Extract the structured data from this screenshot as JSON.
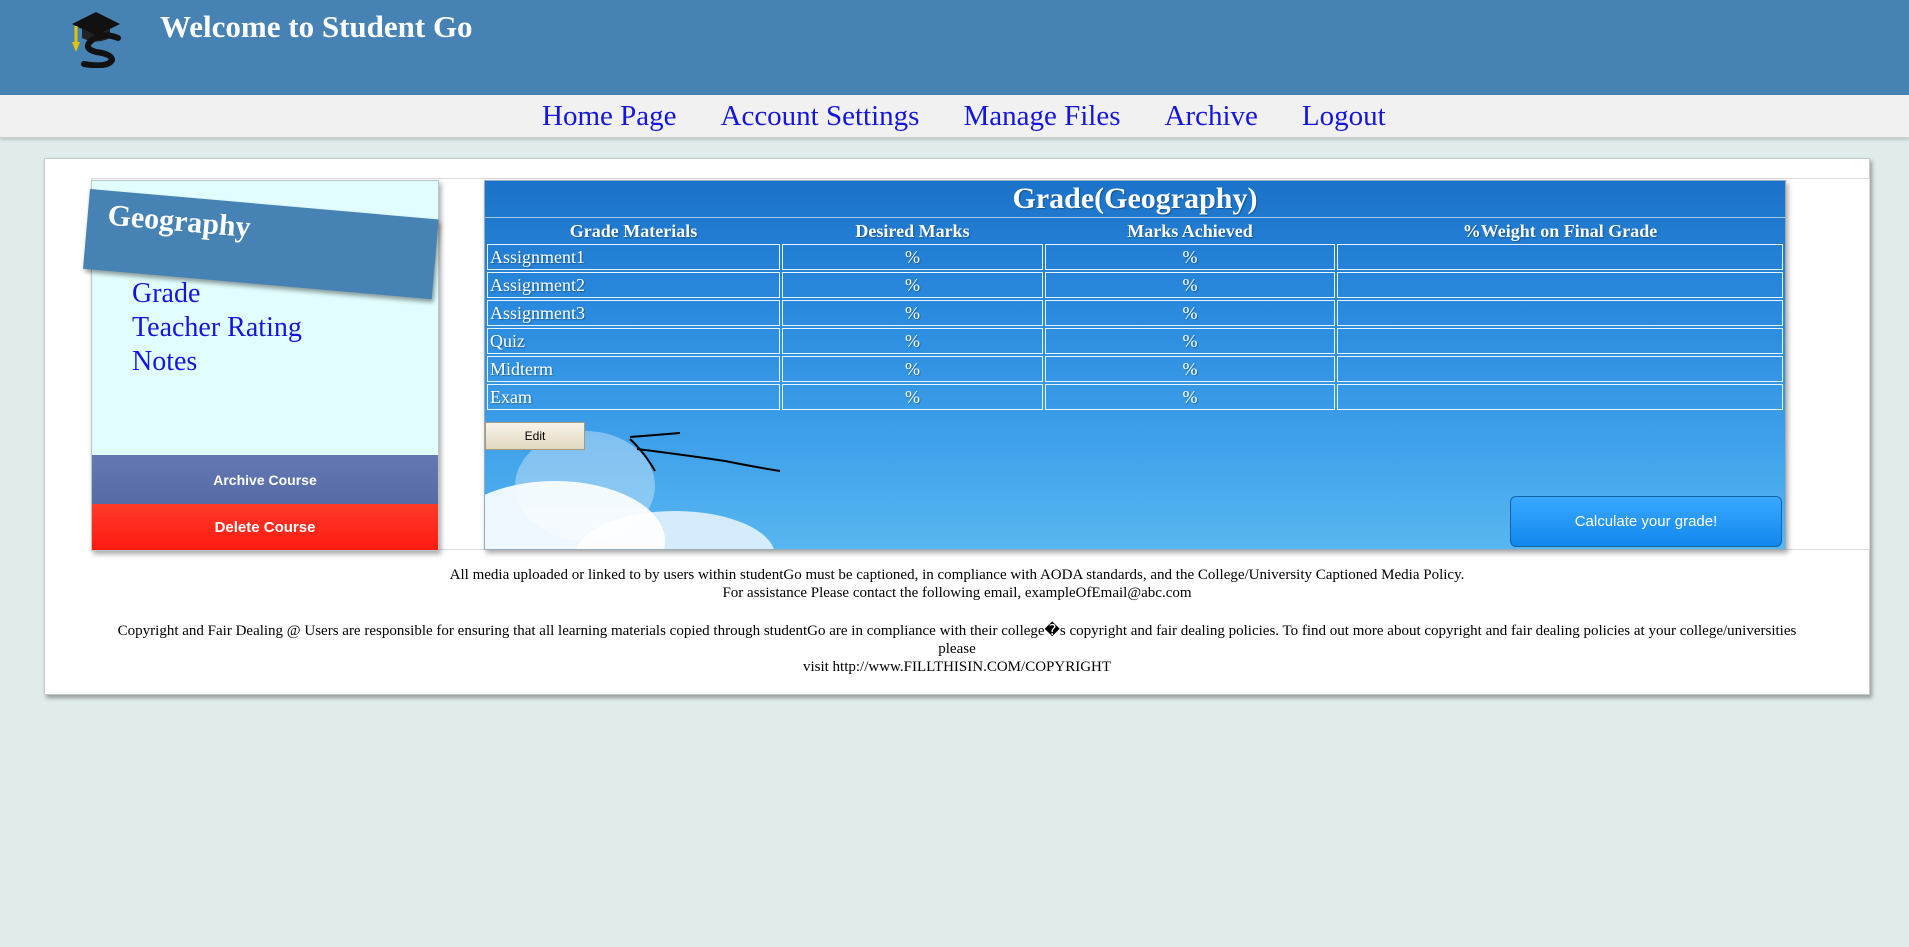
{
  "header": {
    "title": "Welcome to Student Go",
    "logo_icon": "graduation-cap-s-logo"
  },
  "nav": {
    "items": [
      "Home Page",
      "Account Settings",
      "Manage Files",
      "Archive",
      "Logout"
    ]
  },
  "sidebar": {
    "course_name": "Geography",
    "links": [
      "Grade",
      "Teacher Rating",
      "Notes"
    ],
    "archive_label": "Archive Course",
    "delete_label": "Delete Course"
  },
  "grade_panel": {
    "title": "Grade(Geography)",
    "headers": [
      "Grade Materials",
      "Desired Marks",
      "Marks Achieved",
      "%Weight on Final Grade"
    ],
    "rows": [
      {
        "material": "Assignment1",
        "desired": "%",
        "achieved": "%",
        "weight": ""
      },
      {
        "material": "Assignment2",
        "desired": "%",
        "achieved": "%",
        "weight": ""
      },
      {
        "material": "Assignment3",
        "desired": "%",
        "achieved": "%",
        "weight": ""
      },
      {
        "material": "Quiz",
        "desired": "%",
        "achieved": "%",
        "weight": ""
      },
      {
        "material": "Midterm",
        "desired": "%",
        "achieved": "%",
        "weight": ""
      },
      {
        "material": "Exam",
        "desired": "%",
        "achieved": "%",
        "weight": ""
      }
    ],
    "edit_label": "Edit",
    "calculate_label": "Calculate your grade!"
  },
  "footer": {
    "line1": "All media uploaded or linked to by users within studentGo must be captioned, in compliance with AODA standards, and the College/University Captioned Media Policy.",
    "line2": "For assistance Please contact the following email, exampleOfEmail@abc.com",
    "line3": "Copyright and Fair Dealing @ Users are responsible for ensuring that all learning materials copied through studentGo are in compliance with their college�s copyright and fair dealing policies. To find out more about copyright and fair dealing policies at your college/universities please",
    "line4": "visit http://www.FILLTHISIN.COM/COPYRIGHT"
  },
  "colors": {
    "header_bg": "#4682b4",
    "nav_link": "#1515e0",
    "page_bg": "#e0ecec",
    "delete_red": "#ff2a1a",
    "archive_blue": "#5e72ae"
  }
}
